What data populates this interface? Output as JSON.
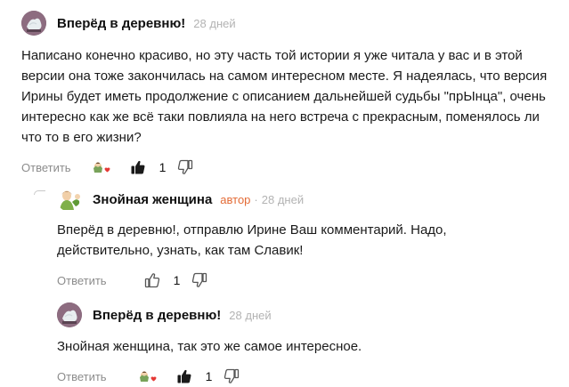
{
  "comments": [
    {
      "author": "Вперёд в деревню!",
      "author_tag": "",
      "date": "28 дней",
      "text": "Написано конечно красиво, но эту часть той истории я уже читала у вас и в этой версии она тоже закончилась на самом интересном месте. Я надеялась, что версия Ирины будет иметь продолжение с описанием дальнейшей судьбы \"прЫнца\", очень интересно как же всё таки повлияла на него встреча с прекрасным, поменялось ли что то в его жизни?",
      "reply_label": "Ответить",
      "likes": "1",
      "avatar_icon": "village-avatar",
      "reaction_icon": "heart-reaction-icon"
    },
    {
      "author": "Знойная женщина",
      "author_tag": "автор",
      "date": "28 дней",
      "text": "Вперёд в деревню!, отправлю Ирине Ваш комментарий. Надо, действительно, узнать, как там Славик!",
      "reply_label": "Ответить",
      "likes": "1",
      "avatar_icon": "woman-avatar",
      "reaction_icon": ""
    },
    {
      "author": "Вперёд в деревню!",
      "author_tag": "",
      "date": "28 дней",
      "text": "Знойная женщина, так это же самое интересное.",
      "reply_label": "Ответить",
      "likes": "1",
      "avatar_icon": "village-avatar",
      "reaction_icon": "heart-reaction-icon"
    }
  ],
  "colors": {
    "author_tag": "#e36b36",
    "muted": "#8c8c8c",
    "date": "#b3b3b3"
  }
}
